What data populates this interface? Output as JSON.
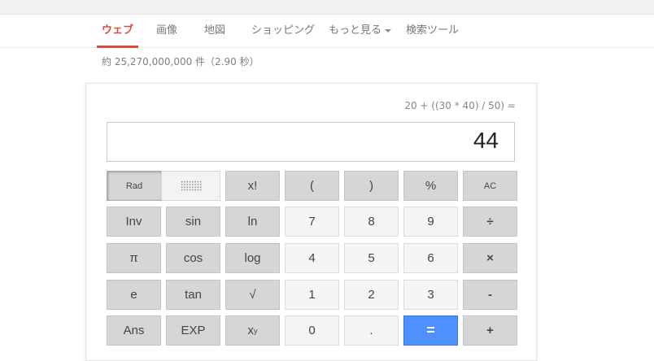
{
  "tabs": [
    {
      "label": "ウェブ",
      "active": true
    },
    {
      "label": "画像"
    },
    {
      "label": "地図"
    },
    {
      "label": "ショッピング"
    },
    {
      "label": "もっと見る",
      "dropdown": true
    },
    {
      "label": "検索ツール"
    }
  ],
  "stats": "約 25,270,000,000 件（2.90 秒）",
  "calculator": {
    "expression": "20 + ((30 * 40) / 50) =",
    "result": "44",
    "buttons": {
      "rad": "Rad",
      "fact": "x!",
      "lparen": "(",
      "rparen": ")",
      "percent": "%",
      "ac": "AC",
      "inv": "Inv",
      "sin": "sin",
      "ln": "ln",
      "seven": "7",
      "eight": "8",
      "nine": "9",
      "divide": "÷",
      "pi": "π",
      "cos": "cos",
      "log": "log",
      "four": "4",
      "five": "5",
      "six": "6",
      "multiply": "×",
      "e": "e",
      "tan": "tan",
      "sqrt": "√",
      "one": "1",
      "two": "2",
      "three": "3",
      "minus": "-",
      "ans": "Ans",
      "exp": "EXP",
      "zero": "0",
      "dot": ".",
      "equals": "=",
      "plus": "+"
    }
  },
  "colors": {
    "accent": "#dd4b39",
    "equals": "#4d90fe"
  }
}
